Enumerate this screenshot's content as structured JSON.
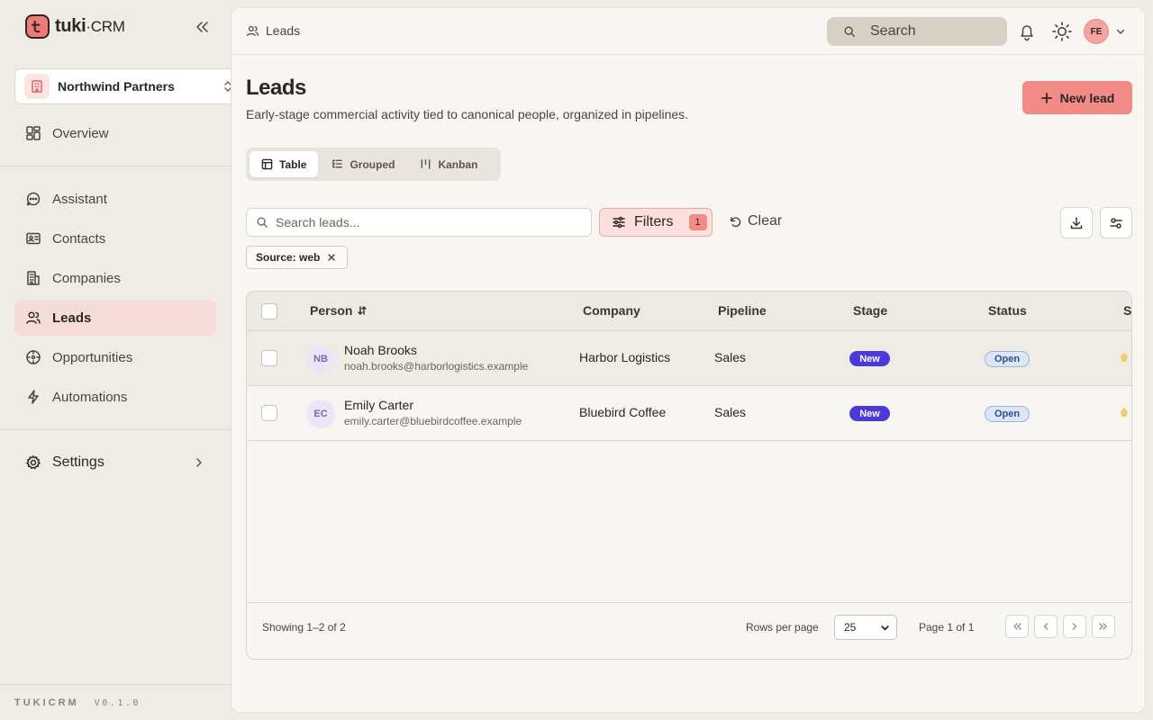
{
  "brand": {
    "name": "tuki",
    "dot": "·",
    "suffix": "CRM"
  },
  "workspace": {
    "name": "Northwind Partners"
  },
  "nav": {
    "overview": "Overview",
    "assistant": "Assistant",
    "contacts": "Contacts",
    "companies": "Companies",
    "leads": "Leads",
    "opportunities": "Opportunities",
    "automations": "Automations",
    "settings": "Settings"
  },
  "version": {
    "name": "TUKICRM",
    "number": "V0.1.0"
  },
  "topbar": {
    "breadcrumb": "Leads",
    "search_placeholder": "Search",
    "avatar_initials": "FE"
  },
  "page": {
    "title": "Leads",
    "subtitle": "Early-stage commercial activity tied to canonical people, organized in pipelines.",
    "new_button": "New lead"
  },
  "views": {
    "table": "Table",
    "grouped": "Grouped",
    "kanban": "Kanban",
    "active": "Table"
  },
  "toolbar": {
    "search_placeholder": "Search leads...",
    "filters_label": "Filters",
    "filters_count": "1",
    "clear_label": "Clear"
  },
  "active_filter": {
    "label": "Source: web"
  },
  "table": {
    "columns": {
      "person": "Person",
      "company": "Company",
      "pipeline": "Pipeline",
      "stage": "Stage",
      "status": "Status",
      "next": "S"
    },
    "rows": [
      {
        "initials": "NB",
        "name": "Noah Brooks",
        "email": "noah.brooks@harborlogistics.example",
        "company": "Harbor Logistics",
        "pipeline": "Sales",
        "stage": "New",
        "status": "Open"
      },
      {
        "initials": "EC",
        "name": "Emily Carter",
        "email": "emily.carter@bluebirdcoffee.example",
        "company": "Bluebird Coffee",
        "pipeline": "Sales",
        "stage": "New",
        "status": "Open"
      }
    ]
  },
  "pagination": {
    "showing": "Showing 1–2 of 2",
    "rows_per_page_label": "Rows per page",
    "rows_per_page": "25",
    "page_info": "Page 1 of 1"
  },
  "colors": {
    "accent": "#f28b86",
    "stage_new": "#4b3ad9",
    "status_open": "#dde6f6",
    "active_nav": "#f6dcd8"
  }
}
